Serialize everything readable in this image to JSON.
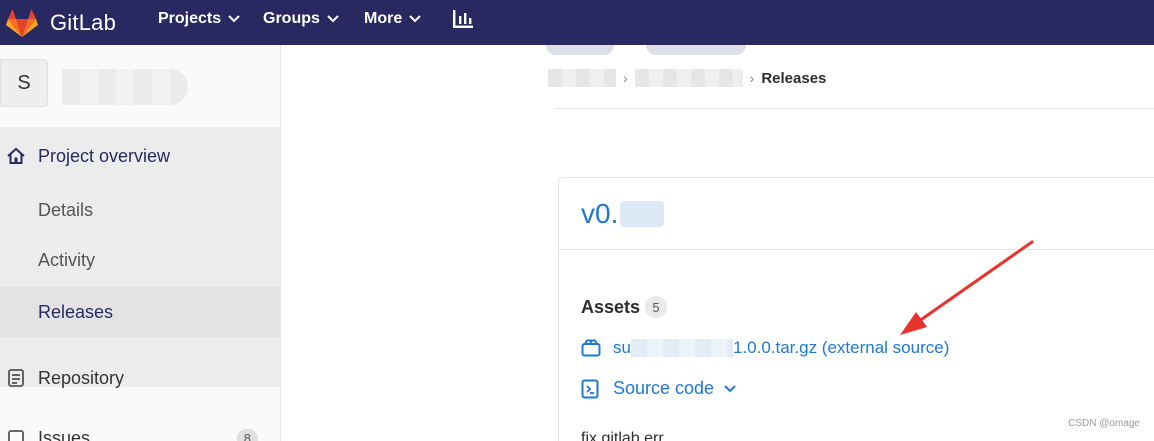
{
  "nav": {
    "logo_text": "GitLab",
    "items": [
      {
        "label": "Projects"
      },
      {
        "label": "Groups"
      },
      {
        "label": "More"
      }
    ],
    "chart_icon": "bar-chart-icon"
  },
  "sidebar": {
    "project_initial": "S",
    "overview_title": "Project overview",
    "overview_items": [
      {
        "label": "Details"
      },
      {
        "label": "Activity"
      },
      {
        "label": "Releases"
      }
    ],
    "repository_label": "Repository",
    "issues_label": "Issues",
    "issues_count": "8"
  },
  "breadcrumb": {
    "current": "Releases"
  },
  "release": {
    "title_prefix": "v0.",
    "assets_label": "Assets",
    "assets_count": "5",
    "asset_prefix": "su",
    "asset_suffix": "1.0.0.tar.gz (external source)",
    "source_code_label": "Source code",
    "description": "fix gitlab err"
  },
  "colors": {
    "nav_bg": "#292961",
    "link": "#1f78d1",
    "arrow": "#e8322b"
  },
  "watermark": "CSDN @omage"
}
